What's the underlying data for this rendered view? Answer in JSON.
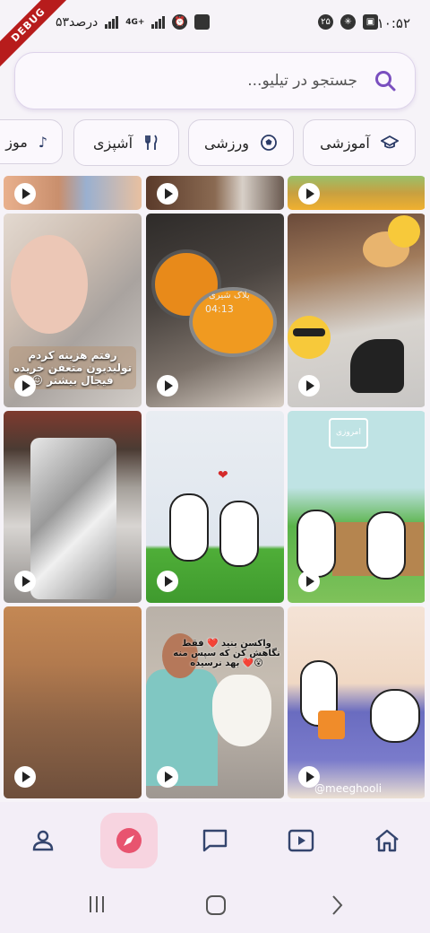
{
  "status_bar": {
    "time": "۱۰:۵۲",
    "notif_count": "۲۵",
    "battery_text": "۵۳درصد",
    "network": "4G+",
    "debug_banner": "DEBUG"
  },
  "search": {
    "placeholder": "جستجو در تیلیو..."
  },
  "categories": [
    {
      "label": "آموزشی",
      "icon": "graduation-cap-icon"
    },
    {
      "label": "ورزشی",
      "icon": "soccer-ball-icon"
    },
    {
      "label": "آشپزی",
      "icon": "fork-knife-icon"
    },
    {
      "label": "موز",
      "icon": "music-note-icon"
    }
  ],
  "tiles": {
    "baby_caption": "رفتم هزینه کردم تولیدیون متعفن خریده فیجال بیشتر 😖",
    "cooking_watermark": "پلاک شیری",
    "cooking_time": "04:13",
    "duck_caption": "واکسن بنید ❤️ فقط نگاهش کن که سپس منه 😮❤️ بهد نرسیده",
    "brand_text": "امروزی",
    "handle": "@meeghooli"
  },
  "colors": {
    "accent": "#7a4fbf",
    "active_nav_bg": "#f7d4e0",
    "active_nav_icon": "#e8546f",
    "nav_bg": "#f3eef7"
  },
  "bottom_nav": [
    "profile-icon",
    "compass-icon",
    "chat-icon",
    "video-icon",
    "home-icon"
  ]
}
